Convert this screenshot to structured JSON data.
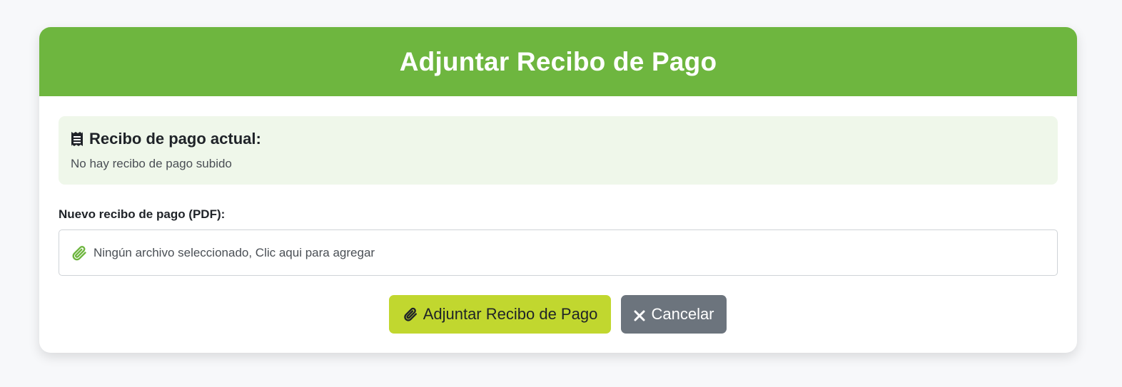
{
  "header": {
    "title": "Adjuntar Recibo de Pago"
  },
  "current_receipt": {
    "title": "Recibo de pago actual:",
    "text": "No hay recibo de pago subido",
    "icon": "receipt-icon"
  },
  "upload": {
    "label": "Nuevo recibo de pago (PDF):",
    "placeholder_text": "Ningún archivo seleccionado, Clic aqui para agregar",
    "icon": "paperclip-icon"
  },
  "buttons": {
    "attach_label": "Adjuntar Recibo de Pago",
    "attach_icon": "paperclip-icon",
    "cancel_label": "Cancelar",
    "cancel_icon": "close-icon"
  },
  "colors": {
    "header_green": "#6eb63f",
    "panel_green": "#eff7ea",
    "attach_button": "#c1d72f",
    "cancel_button": "#6c747d"
  }
}
